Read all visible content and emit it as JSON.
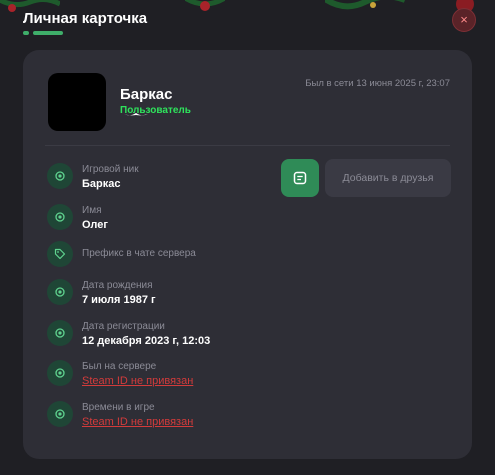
{
  "window": {
    "title": "Личная карточка",
    "close_label": "×"
  },
  "profile": {
    "username": "Баркас",
    "role": "Пользователь",
    "last_seen": "Был в сети 13 июня 2025 г, 23:07"
  },
  "actions": {
    "add_friend_label": "Добавить в друзья"
  },
  "fields": [
    {
      "label": "Игровой ник",
      "value": "Баркас"
    },
    {
      "label": "Имя",
      "value": "Олег"
    },
    {
      "label": "Префикс в чате сервера",
      "value": ""
    },
    {
      "label": "Дата рождения",
      "value": "7 июля 1987 г"
    },
    {
      "label": "Дата регистрации",
      "value": "12 декабря 2023 г, 12:03"
    },
    {
      "label": "Был на сервере",
      "value": "Steam ID не привязан"
    },
    {
      "label": "Времени в игре",
      "value": "Steam ID не привязан"
    }
  ],
  "colors": {
    "accent": "#2f8b57",
    "role": "#2ee35c",
    "link_error": "#d33b3b",
    "card_bg": "#2e2e36",
    "page_bg": "#1f1f24"
  }
}
